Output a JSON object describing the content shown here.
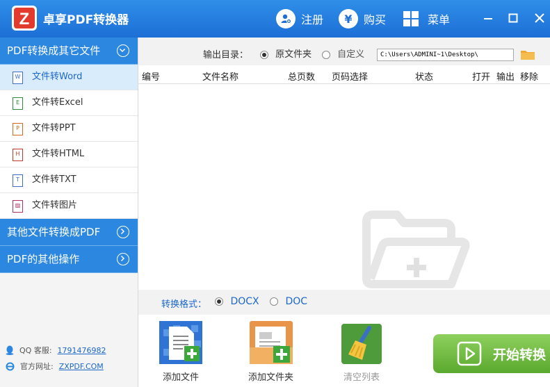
{
  "app": {
    "title": "卓享PDF转换器",
    "logo_letter": "Z"
  },
  "titlebar": {
    "register": "注册",
    "buy": "购买",
    "menu": "菜单",
    "yen_symbol": "¥"
  },
  "sidebar": {
    "section1": "PDF转换成其它文件",
    "items": [
      {
        "label": "文件转Word",
        "icon": "W"
      },
      {
        "label": "文件转Excel",
        "icon": "E"
      },
      {
        "label": "文件转PPT",
        "icon": "P"
      },
      {
        "label": "文件转HTML",
        "icon": "H"
      },
      {
        "label": "文件转TXT",
        "icon": "T"
      },
      {
        "label": "文件转图片",
        "icon": "▨"
      }
    ],
    "section2": "其他文件转换成PDF",
    "section3": "PDF的其他操作",
    "qq_label": "QQ 客服:",
    "qq_value": "1791476982",
    "site_label": "官方网址:",
    "site_value": "ZXPDF.COM"
  },
  "output": {
    "label": "输出目录：",
    "option1": "原文件夹",
    "option2": "自定义",
    "path": "C:\\Users\\ADMINI~1\\Desktop\\"
  },
  "table": {
    "headers": [
      "编号",
      "文件名称",
      "总页数",
      "页码选择",
      "状态",
      "打开",
      "输出",
      "移除"
    ]
  },
  "format": {
    "label": "转换格式：",
    "option1": "DOCX",
    "option2": "DOC"
  },
  "actions": {
    "add_file": "添加文件",
    "add_folder": "添加文件夹",
    "clear_list": "清空列表",
    "start": "开始转换"
  },
  "colors": {
    "accent": "#2c87e0",
    "titlebar": "#1d6fd6",
    "start_green": "#6dbb3d"
  }
}
